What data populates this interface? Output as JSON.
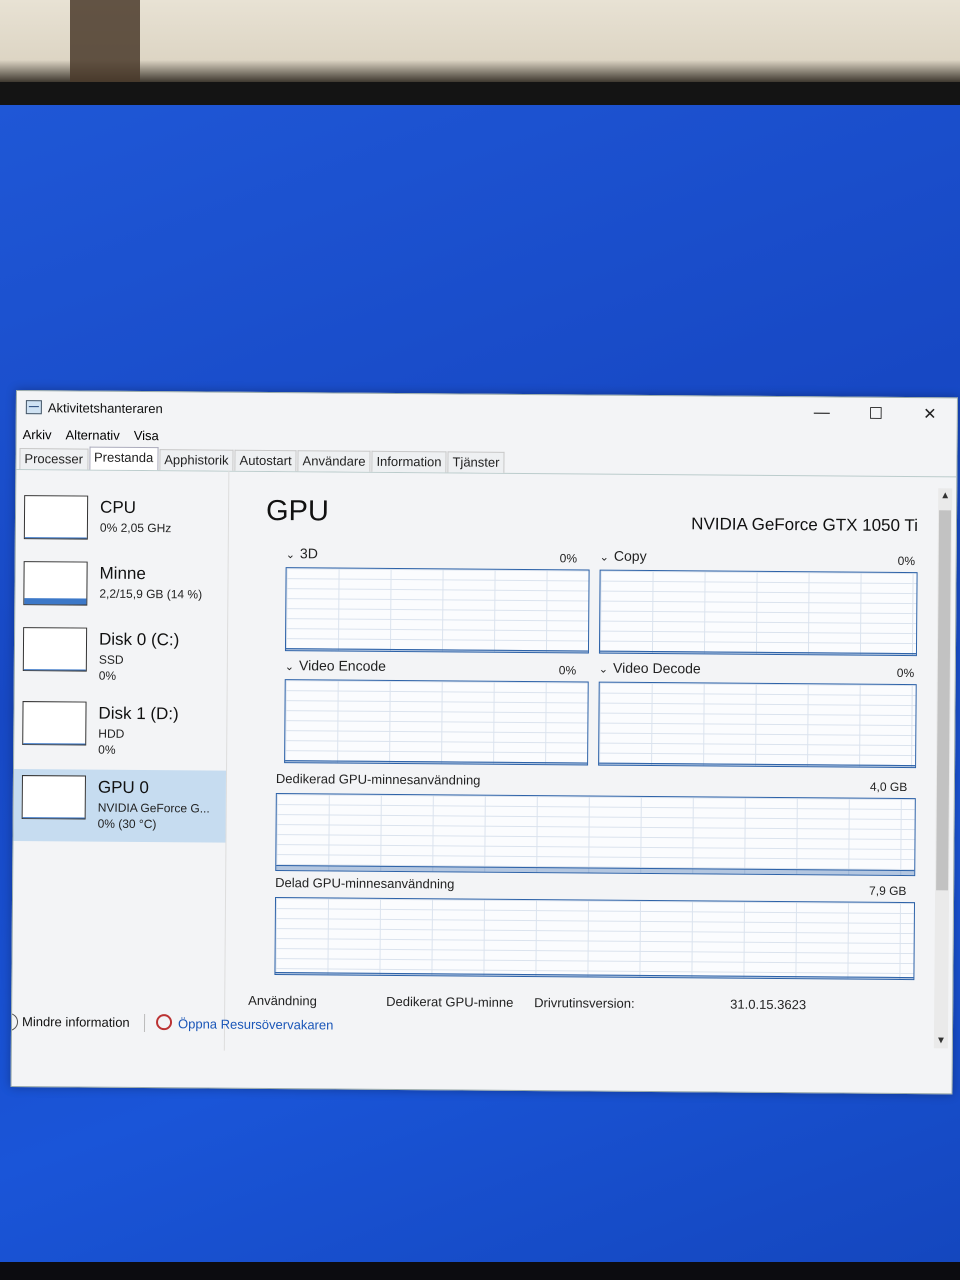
{
  "window": {
    "title": "Aktivitetshanteraren",
    "minimize_glyph": "—",
    "maximize_glyph": "☐",
    "close_glyph": "✕"
  },
  "menu": [
    "Arkiv",
    "Alternativ",
    "Visa"
  ],
  "tabs": [
    "Processer",
    "Prestanda",
    "Apphistorik",
    "Autostart",
    "Användare",
    "Information",
    "Tjänster"
  ],
  "active_tab": "Prestanda",
  "sidebar": [
    {
      "name": "CPU",
      "line1": "0% 2,05 GHz",
      "line2": "",
      "usage": 0.0
    },
    {
      "name": "Minne",
      "line1": "2,2/15,9 GB (14 %)",
      "line2": "",
      "usage": 0.14
    },
    {
      "name": "Disk 0 (C:)",
      "line1": "SSD",
      "line2": "0%",
      "usage": 0.0
    },
    {
      "name": "Disk 1 (D:)",
      "line1": "HDD",
      "line2": "0%",
      "usage": 0.0
    },
    {
      "name": "GPU 0",
      "line1": "NVIDIA GeForce G...",
      "line2": "0% (30 °C)",
      "usage": 0.0,
      "selected": true
    }
  ],
  "main": {
    "title": "GPU",
    "model": "NVIDIA GeForce GTX 1050 Ti",
    "engines": [
      {
        "label": "3D",
        "value": "0%"
      },
      {
        "label": "Copy",
        "value": "0%"
      },
      {
        "label": "Video Encode",
        "value": "0%"
      },
      {
        "label": "Video Decode",
        "value": "0%"
      }
    ],
    "dedicated": {
      "label": "Dedikerad GPU-minnesanvändning",
      "max": "4,0 GB",
      "usage": 0.05
    },
    "shared": {
      "label": "Delad GPU-minnesanvändning",
      "max": "7,9 GB",
      "usage": 0.0
    },
    "stats": {
      "usage_label": "Användning",
      "dedicated_label": "Dedikerat GPU-minne",
      "driver_label": "Drivrutinsversion:",
      "driver_value": "31.0.15.3623"
    }
  },
  "footer": {
    "less_info": "Mindre information",
    "open_monitor": "Öppna Resursövervakaren"
  },
  "colors": {
    "desktop": "#1a4fd0",
    "graph_line": "#2d62a8",
    "selected_bg": "#c6dcf0",
    "link": "#1a56b8"
  }
}
